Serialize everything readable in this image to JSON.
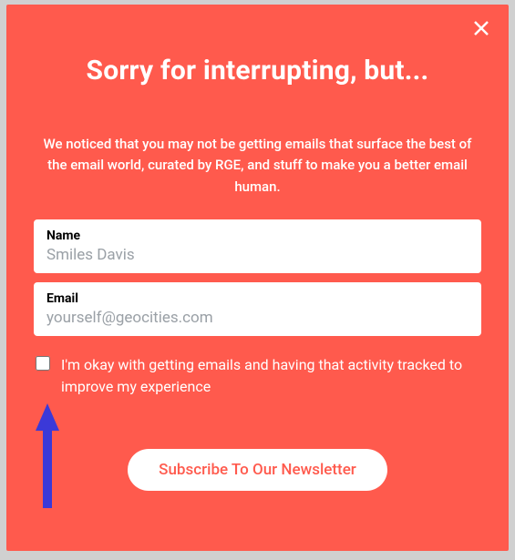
{
  "modal": {
    "title": "Sorry for interrupting, but...",
    "subtitle": "We noticed that you may not be getting emails that surface the best of the email world, curated by RGE, and stuff to make you a better email human.",
    "name_field": {
      "label": "Name",
      "placeholder": "Smiles Davis",
      "value": ""
    },
    "email_field": {
      "label": "Email",
      "placeholder": "yourself@geocities.com",
      "value": ""
    },
    "consent_text": "I'm okay with getting emails and having that activity tracked to improve my experience",
    "submit_label": "Subscribe To Our Newsletter"
  }
}
